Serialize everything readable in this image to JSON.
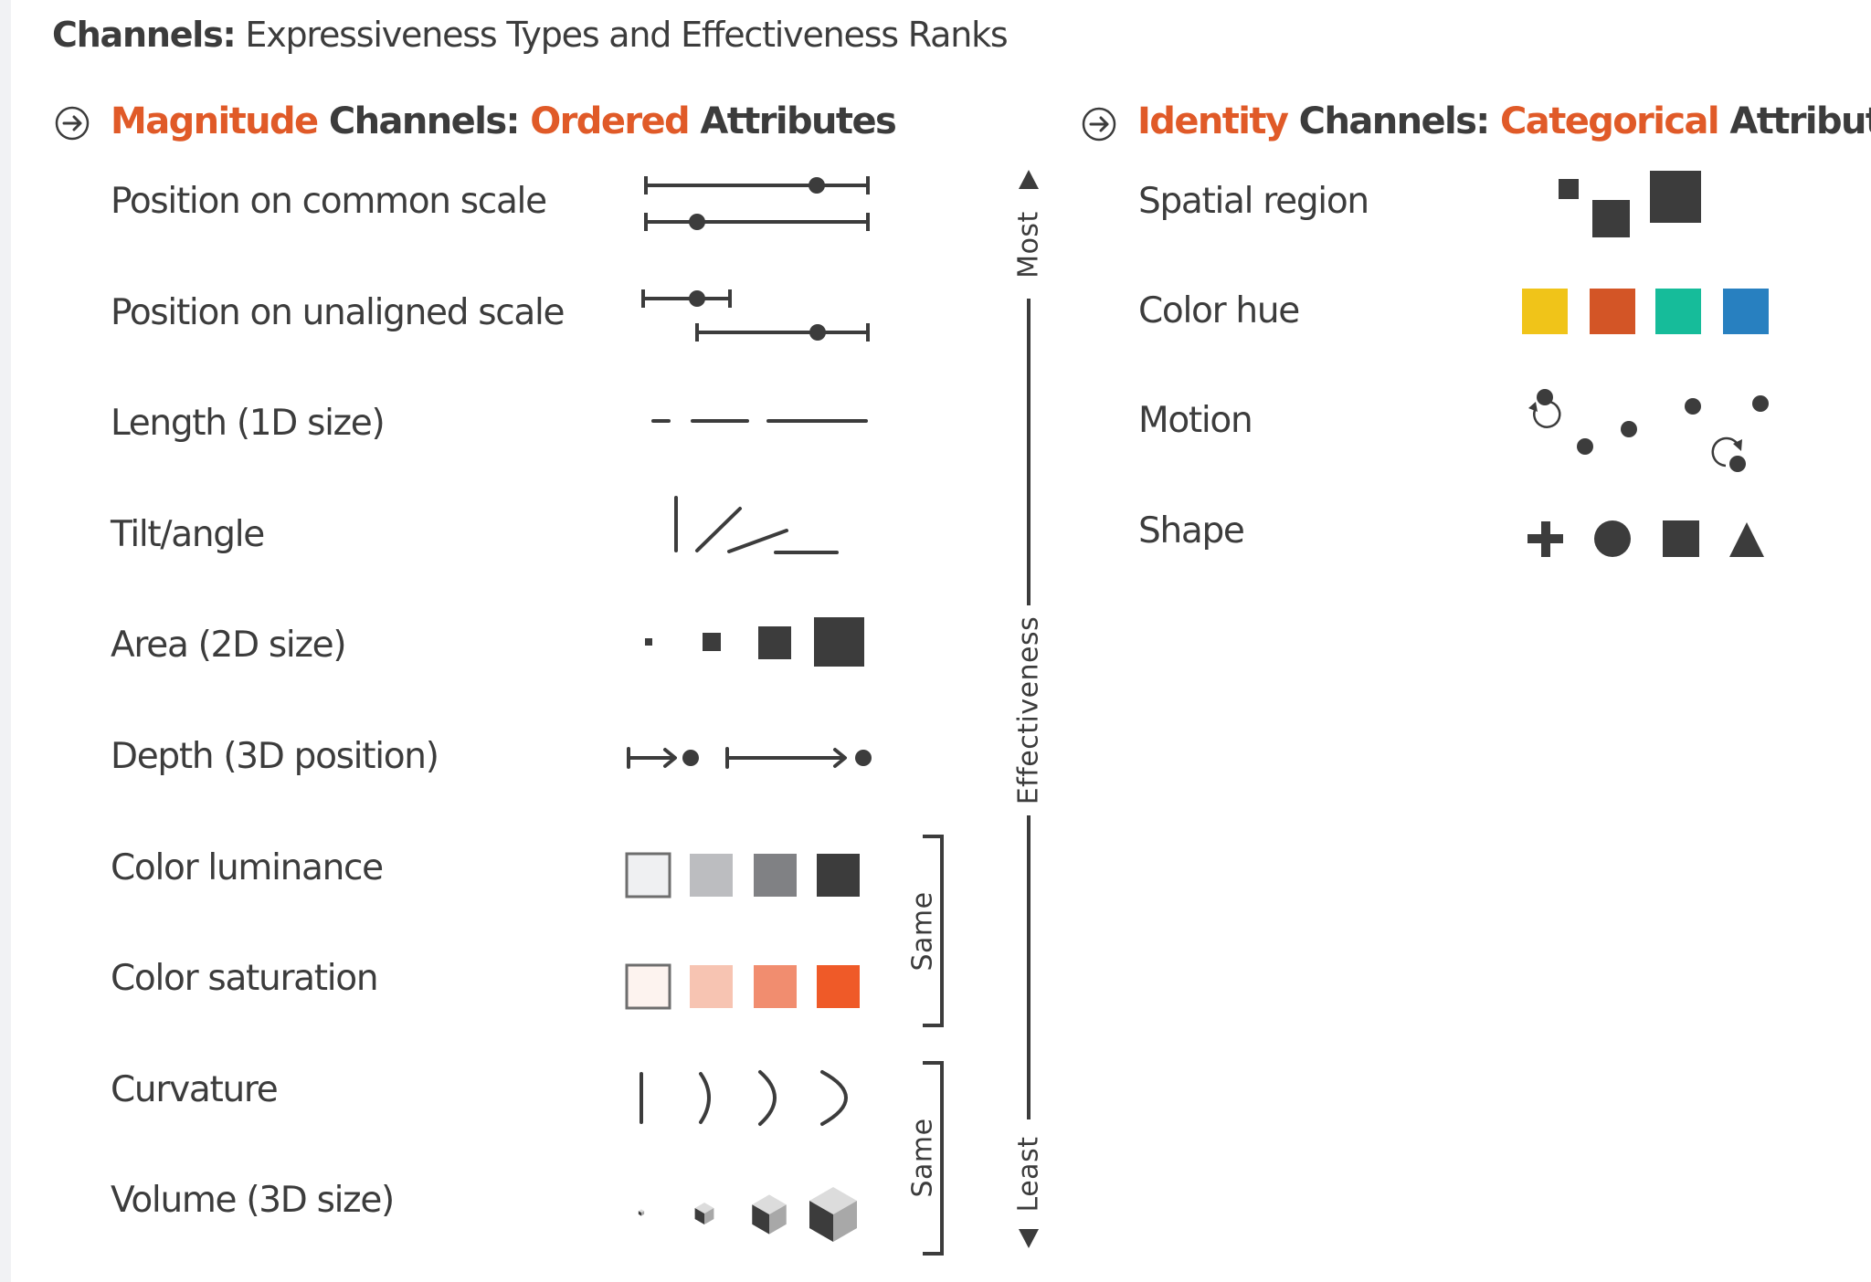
{
  "title": {
    "bold": "Channels:",
    "rest": " Expressiveness Types and Effectiveness Ranks"
  },
  "magnitude": {
    "heading": {
      "accent1": "Magnitude",
      "text1": " Channels: ",
      "accent2": "Ordered",
      "text2": " Attributes"
    },
    "icon": "arrow-circle-icon",
    "rows": [
      {
        "label": "Position on common scale",
        "glyph": "position-common-scale"
      },
      {
        "label": "Position on unaligned scale",
        "glyph": "position-unaligned-scale"
      },
      {
        "label": "Length (1D size)",
        "glyph": "length"
      },
      {
        "label": "Tilt/angle",
        "glyph": "tilt-angle"
      },
      {
        "label": "Area (2D size)",
        "glyph": "area"
      },
      {
        "label": "Depth (3D position)",
        "glyph": "depth"
      },
      {
        "label": "Color luminance",
        "glyph": "color-luminance"
      },
      {
        "label": "Color saturation",
        "glyph": "color-saturation"
      },
      {
        "label": "Curvature",
        "glyph": "curvature"
      },
      {
        "label": "Volume (3D size)",
        "glyph": "volume"
      }
    ],
    "luminance_colors": [
      "#eff0f2",
      "#bcbdc0",
      "#808184",
      "#3c3c3c"
    ],
    "saturation_colors": [
      "#fdf3ef",
      "#f7c4b2",
      "#f18d6f",
      "#ef5a28"
    ]
  },
  "identity": {
    "heading": {
      "accent1": "Identity",
      "text1": " Channels: ",
      "accent2": "Categorical",
      "text2": " Attributes"
    },
    "icon": "arrow-circle-icon",
    "rows": [
      {
        "label": "Spatial region",
        "glyph": "spatial-region"
      },
      {
        "label": "Color hue",
        "glyph": "color-hue"
      },
      {
        "label": "Motion",
        "glyph": "motion"
      },
      {
        "label": "Shape",
        "glyph": "shape"
      }
    ],
    "hue_colors": [
      "#f0c419",
      "#d35526",
      "#16bc9a",
      "#2880c0"
    ]
  },
  "effectiveness_axis": {
    "top": "Most",
    "middle": "Effectiveness",
    "bottom": "Least"
  },
  "groups": [
    {
      "label": "Same",
      "members": [
        "Color luminance",
        "Color saturation"
      ]
    },
    {
      "label": "Same",
      "members": [
        "Curvature",
        "Volume (3D size)"
      ]
    }
  ],
  "colors": {
    "accent": "#e05a28",
    "ink": "#3c3c3c"
  }
}
